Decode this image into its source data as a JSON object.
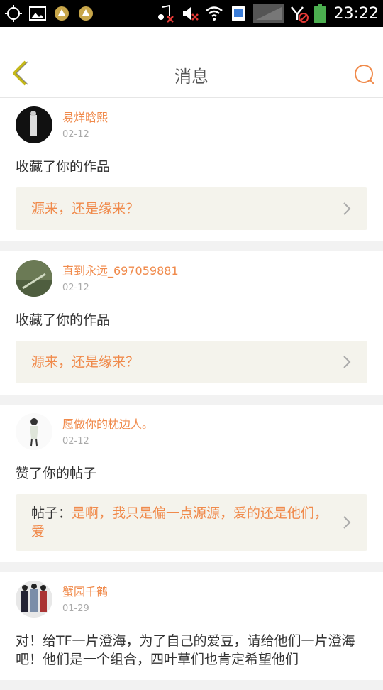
{
  "statusbar": {
    "time": "23:22"
  },
  "header": {
    "title": "消息"
  },
  "colors": {
    "accent": "#f08a4b",
    "box_bg": "#f4f3ec"
  },
  "messages": [
    {
      "name": "易烊晗熙",
      "date": "02-12",
      "action": "收藏了你的作品",
      "box_prefix": "",
      "box_text": "源来，还是缘来？"
    },
    {
      "name": "直到永远_697059881",
      "date": "02-12",
      "action": "收藏了你的作品",
      "box_prefix": "",
      "box_text": "源来，还是缘来？"
    },
    {
      "name": "愿做你的枕边人。",
      "date": "02-12",
      "action": "赞了你的帖子",
      "box_prefix": "帖子：",
      "box_text": "是啊，我只是偏一点源源，爱的还是他们，爱"
    },
    {
      "name": "蟹园千鹤",
      "date": "01-29",
      "action": "对！给TF一片澄海，为了自己的爱豆，请给他们一片澄海吧！他们是一个组合，四叶草们也肯定希望他们"
    }
  ]
}
